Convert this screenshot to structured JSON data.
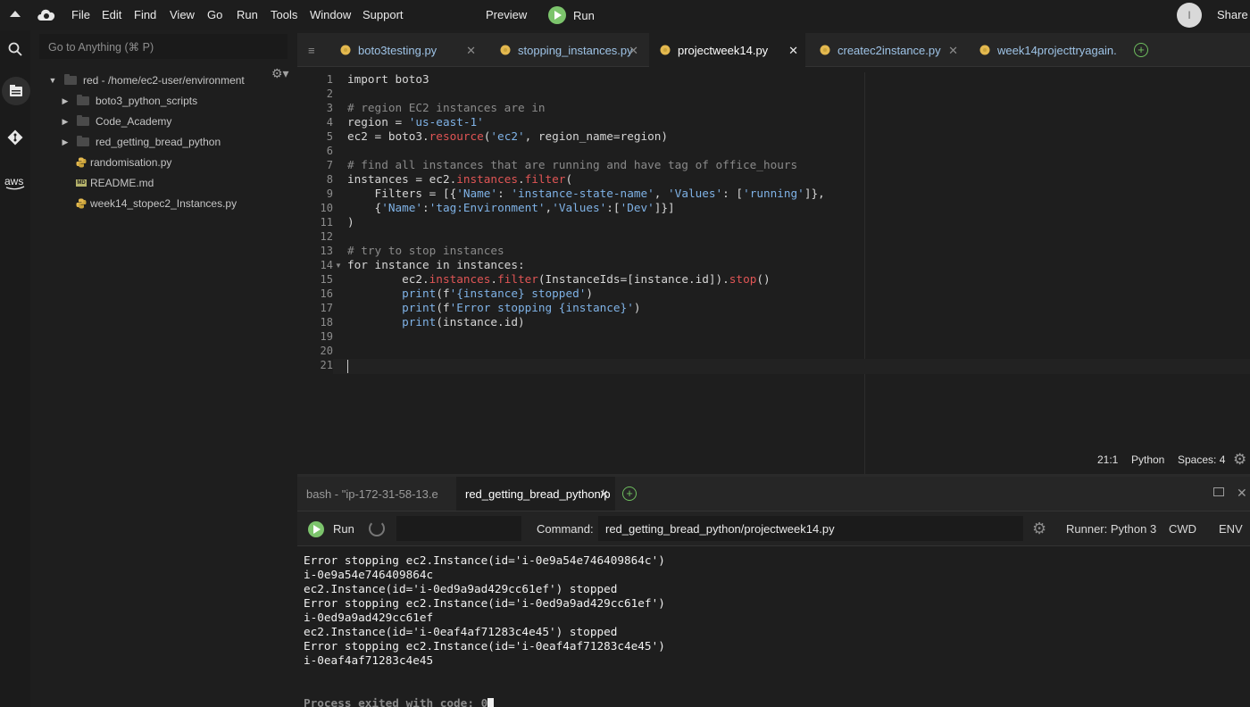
{
  "menubar": {
    "items": [
      "File",
      "Edit",
      "Find",
      "View",
      "Go",
      "Run",
      "Tools",
      "Window",
      "Support"
    ],
    "preview": "Preview",
    "run": "Run",
    "avatar": "I",
    "share": "Share"
  },
  "filetree": {
    "search_placeholder": "Go to Anything (⌘ P)",
    "root": "red - /home/ec2-user/environment",
    "items": [
      {
        "label": "boto3_python_scripts",
        "type": "folder"
      },
      {
        "label": "Code_Academy",
        "type": "folder"
      },
      {
        "label": "red_getting_bread_python",
        "type": "folder"
      },
      {
        "label": "randomisation.py",
        "type": "py"
      },
      {
        "label": "README.md",
        "type": "md"
      },
      {
        "label": "week14_stopec2_Instances.py",
        "type": "py"
      }
    ]
  },
  "editor": {
    "tabs": [
      {
        "label": "boto3testing.py",
        "active": false
      },
      {
        "label": "stopping_instances.py",
        "active": false
      },
      {
        "label": "projectweek14.py",
        "active": true
      },
      {
        "label": "createc2instance.py",
        "active": false
      },
      {
        "label": "week14projecttryagain.",
        "active": false
      }
    ],
    "line_numbers": [
      "1",
      "2",
      "3",
      "4",
      "5",
      "6",
      "7",
      "8",
      "9",
      "10",
      "11",
      "12",
      "13",
      "14",
      "15",
      "16",
      "17",
      "18",
      "19",
      "20",
      "21"
    ],
    "status": {
      "position": "21:1",
      "language": "Python",
      "spaces": "Spaces: 4"
    }
  },
  "code_lines": [
    "import boto3",
    "",
    "# region EC2 instances are in",
    "region = 'us-east-1'",
    "ec2 = boto3.resource('ec2', region_name=region)",
    "",
    "# find all instances that are running and have tag of office_hours",
    "instances = ec2.instances.filter(",
    "    Filters = [{'Name': 'instance-state-name', 'Values': ['running']},",
    "    {'Name':'tag:Environment','Values':['Dev']}]",
    ")",
    "",
    "# try to stop instances",
    "for instance in instances:",
    "        ec2.instances.filter(InstanceIds=[instance.id]).stop()",
    "        print(f'{instance} stopped')",
    "        print(f'Error stopping {instance}')",
    "        print(instance.id)",
    "",
    "",
    ""
  ],
  "terminal": {
    "tabs": [
      {
        "label": "bash - \"ip-172-31-58-13.e",
        "active": false
      },
      {
        "label": "red_getting_bread_python/p",
        "active": true
      }
    ],
    "run_label": "Run",
    "command_label": "Command:",
    "command_value": "red_getting_bread_python/projectweek14.py",
    "runner": "Runner: Python 3",
    "cwd": "CWD",
    "env": "ENV",
    "output": [
      "Error stopping ec2.Instance(id='i-0e9a54e746409864c')",
      "i-0e9a54e746409864c",
      "ec2.Instance(id='i-0ed9a9ad429cc61ef') stopped",
      "Error stopping ec2.Instance(id='i-0ed9a9ad429cc61ef')",
      "i-0ed9a9ad429cc61ef",
      "ec2.Instance(id='i-0eaf4af71283c4e45') stopped",
      "Error stopping ec2.Instance(id='i-0eaf4af71283c4e45')",
      "i-0eaf4af71283c4e45",
      "",
      "",
      "Process exited with code: 0"
    ]
  },
  "colors": {
    "accent_green": "#7cc46c",
    "string_blue": "#7fb2e6",
    "method_red": "#e05555"
  }
}
